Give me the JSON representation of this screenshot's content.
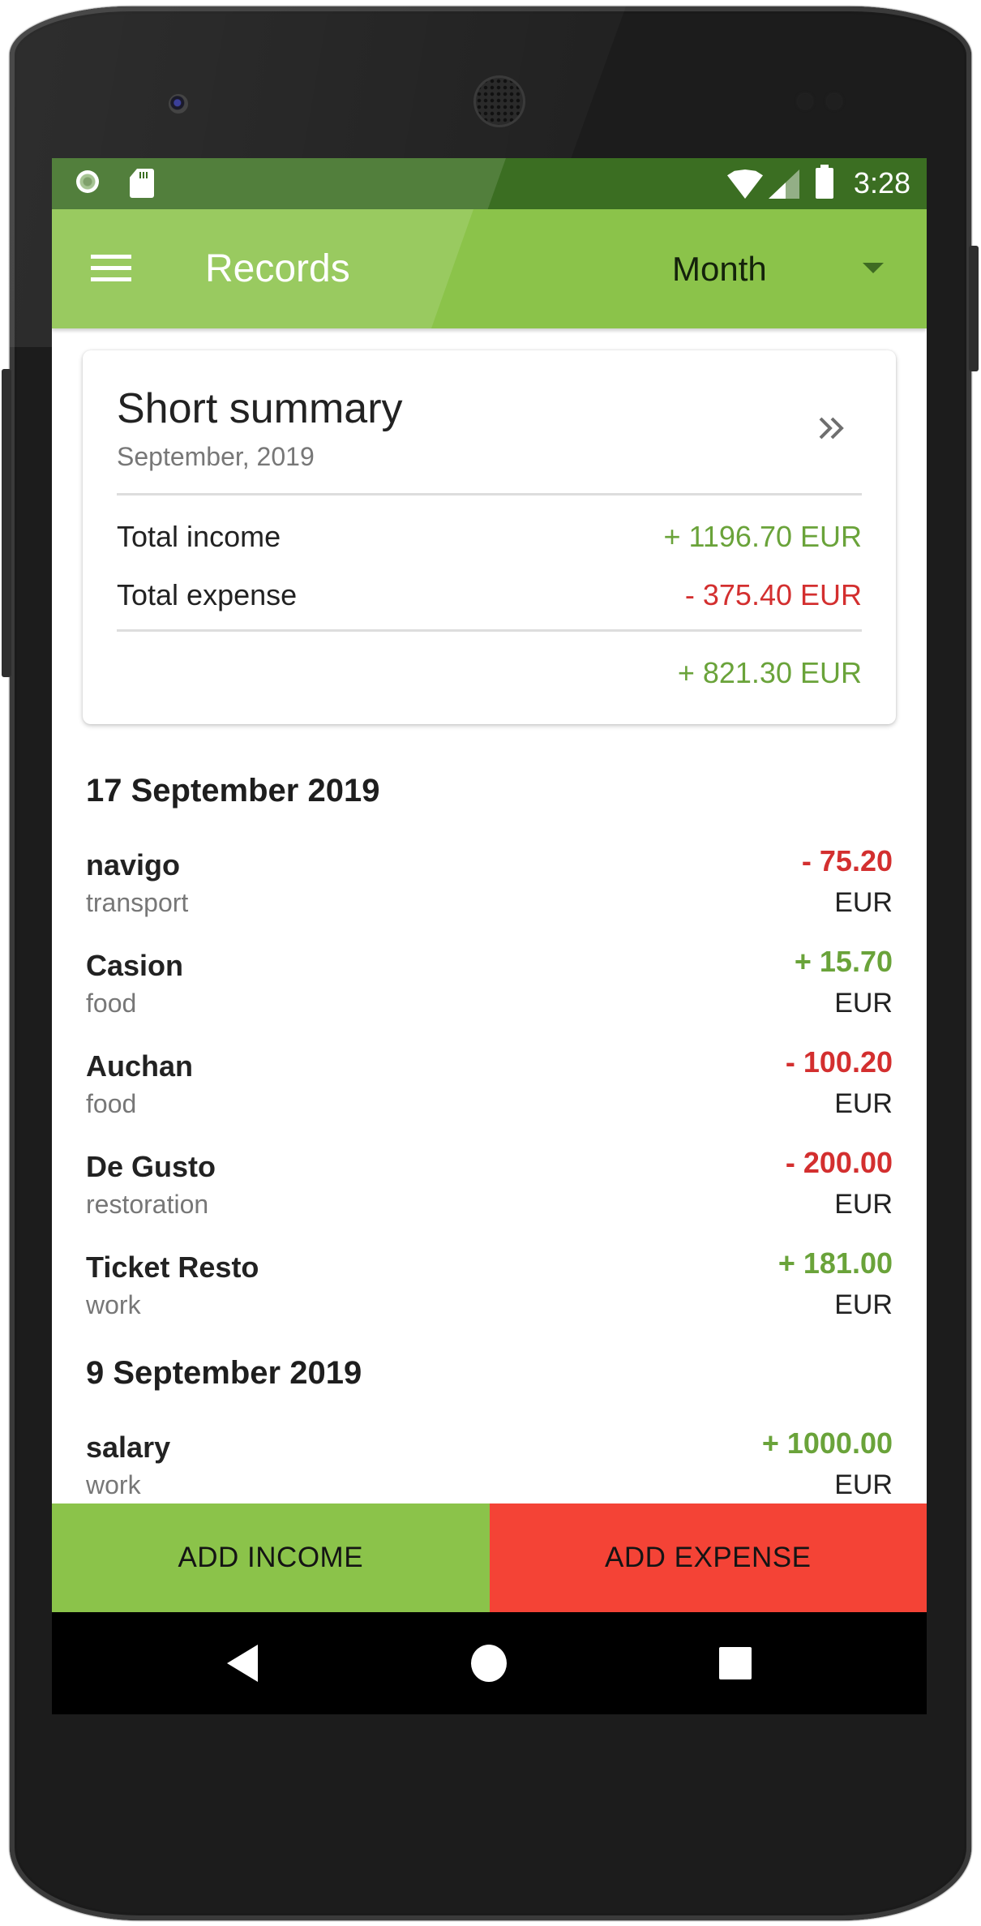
{
  "status_bar": {
    "time": "3:28",
    "left_icons": [
      "screen-record-icon",
      "sd-card-icon"
    ],
    "right_icons": [
      "wifi-icon",
      "cell-signal-icon",
      "battery-icon"
    ]
  },
  "toolbar": {
    "title": "Records",
    "period_selected": "Month",
    "menu_icon": "hamburger-menu-icon",
    "dropdown_icon": "caret-down-icon",
    "color": "#8bc34a"
  },
  "summary": {
    "title": "Short summary",
    "period": "September, 2019",
    "expand_icon": "double-chevron-right-icon",
    "income_label": "Total income",
    "income_value": "+ 1196.70 EUR",
    "expense_label": "Total expense",
    "expense_value": "- 375.40 EUR",
    "balance_value": "+ 821.30 EUR"
  },
  "days": [
    {
      "date": "17 September 2019",
      "records": [
        {
          "name": "navigo",
          "category": "transport",
          "amount": "- 75.20",
          "currency": "EUR",
          "type": "expense"
        },
        {
          "name": "Casion",
          "category": "food",
          "amount": "+ 15.70",
          "currency": "EUR",
          "type": "income"
        },
        {
          "name": "Auchan",
          "category": "food",
          "amount": "- 100.20",
          "currency": "EUR",
          "type": "expense"
        },
        {
          "name": "De Gusto",
          "category": "restoration",
          "amount": "- 200.00",
          "currency": "EUR",
          "type": "expense"
        },
        {
          "name": "Ticket Resto",
          "category": "work",
          "amount": "+ 181.00",
          "currency": "EUR",
          "type": "income"
        }
      ]
    },
    {
      "date": "9 September 2019",
      "records": [
        {
          "name": "salary",
          "category": "work",
          "amount": "+ 1000.00",
          "currency": "EUR",
          "type": "income"
        }
      ]
    }
  ],
  "actions": {
    "add_income": "ADD INCOME",
    "add_expense": "ADD EXPENSE",
    "income_color": "#8bc34a",
    "expense_color": "#f44336"
  },
  "colors": {
    "positive": "#6aa33a",
    "negative": "#d32f2f",
    "status_bar": "#3b6e22"
  },
  "nav_bar": {
    "buttons": [
      "back-icon",
      "home-icon",
      "recents-icon"
    ]
  }
}
